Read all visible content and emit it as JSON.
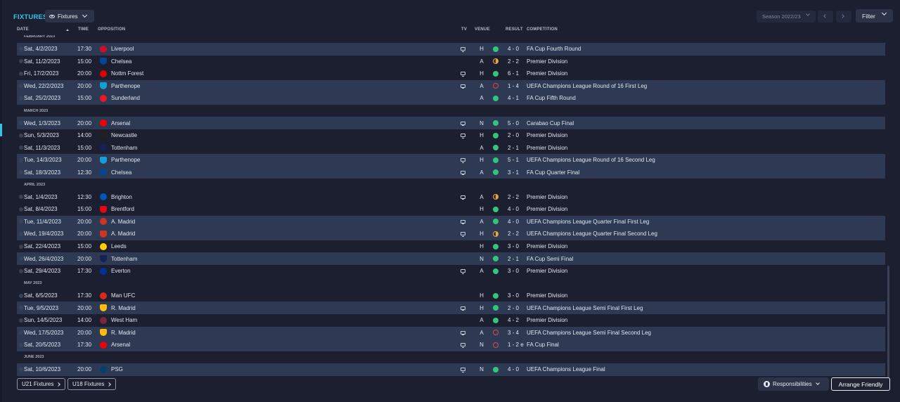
{
  "header": {
    "title": "FIXTURES",
    "view_label": "Fixtures",
    "season_label": "Season 2022/23",
    "filter_label": "Filter"
  },
  "columns": {
    "date": "DATE",
    "time": "TIME",
    "opposition": "OPPOSITION",
    "tv": "TV",
    "venue": "VENUE",
    "result": "RESULT",
    "competition": "COMPETITION"
  },
  "sections": [
    {
      "label": "FEBRUARY 2023",
      "fixtures": [
        {
          "date": "Sat, 4/2/2023",
          "time": "17:30",
          "opponent": "Liverpool",
          "crest": "#c8102e",
          "tv": true,
          "venue": "H",
          "outcome": "win",
          "score": "4 - 0",
          "competition": "FA Cup Fourth Round",
          "highlight": true
        },
        {
          "date": "Sat, 11/2/2023",
          "time": "15:00",
          "opponent": "Chelsea",
          "crest": "#034694",
          "tv": false,
          "venue": "A",
          "outcome": "draw",
          "score": "2 - 2",
          "competition": "Premier Division",
          "highlight": false
        },
        {
          "date": "Fri, 17/2/2023",
          "time": "20:00",
          "opponent": "Nottm Forest",
          "crest": "#dd0000",
          "tv": true,
          "venue": "H",
          "outcome": "win",
          "score": "6 - 1",
          "competition": "Premier Division",
          "highlight": false
        },
        {
          "date": "Wed, 22/2/2023",
          "time": "20:00",
          "opponent": "Parthenope",
          "crest": "#12a0d7",
          "tv": true,
          "venue": "A",
          "outcome": "loss",
          "score": "1 - 4",
          "competition": "UEFA Champions League Round of 16 First Leg",
          "highlight": true
        },
        {
          "date": "Sat, 25/2/2023",
          "time": "15:00",
          "opponent": "Sunderland",
          "crest": "#eb172b",
          "tv": false,
          "venue": "A",
          "outcome": "win",
          "score": "4 - 1",
          "competition": "FA Cup Fifth Round",
          "highlight": true
        }
      ]
    },
    {
      "label": "MARCH 2023",
      "fixtures": [
        {
          "date": "Wed, 1/3/2023",
          "time": "20:00",
          "opponent": "Arsenal",
          "crest": "#ef0107",
          "tv": true,
          "venue": "N",
          "outcome": "win",
          "score": "5 - 0",
          "competition": "Carabao Cup Final",
          "highlight": true
        },
        {
          "date": "Sun, 5/3/2023",
          "time": "14:00",
          "opponent": "Newcastle",
          "crest": "#241f20",
          "tv": true,
          "venue": "H",
          "outcome": "win",
          "score": "2 - 0",
          "competition": "Premier Division",
          "highlight": false
        },
        {
          "date": "Sat, 11/3/2023",
          "time": "15:00",
          "opponent": "Tottenham",
          "crest": "#132257",
          "tv": false,
          "venue": "A",
          "outcome": "win",
          "score": "2 - 1",
          "competition": "Premier Division",
          "highlight": false
        },
        {
          "date": "Tue, 14/3/2023",
          "time": "20:00",
          "opponent": "Parthenope",
          "crest": "#12a0d7",
          "tv": true,
          "venue": "H",
          "outcome": "win",
          "score": "5 - 1",
          "competition": "UEFA Champions League Round of 16 Second Leg",
          "highlight": true
        },
        {
          "date": "Sat, 18/3/2023",
          "time": "12:30",
          "opponent": "Chelsea",
          "crest": "#034694",
          "tv": true,
          "venue": "A",
          "outcome": "win",
          "score": "3 - 1",
          "competition": "FA Cup Quarter Final",
          "highlight": true
        }
      ]
    },
    {
      "label": "APRIL 2023",
      "fixtures": [
        {
          "date": "Sat, 1/4/2023",
          "time": "12:30",
          "opponent": "Brighton",
          "crest": "#0057b8",
          "tv": true,
          "venue": "A",
          "outcome": "draw",
          "score": "2 - 2",
          "competition": "Premier Division",
          "highlight": false
        },
        {
          "date": "Sat, 8/4/2023",
          "time": "15:00",
          "opponent": "Brentford",
          "crest": "#e30613",
          "tv": false,
          "venue": "H",
          "outcome": "win",
          "score": "4 - 0",
          "competition": "Premier Division",
          "highlight": false
        },
        {
          "date": "Tue, 11/4/2023",
          "time": "20:00",
          "opponent": "A. Madrid",
          "crest": "#cb3524",
          "tv": true,
          "venue": "A",
          "outcome": "win",
          "score": "4 - 0",
          "competition": "UEFA Champions League Quarter Final First Leg",
          "highlight": true
        },
        {
          "date": "Wed, 19/4/2023",
          "time": "20:00",
          "opponent": "A. Madrid",
          "crest": "#cb3524",
          "tv": true,
          "venue": "H",
          "outcome": "draw",
          "score": "2 - 2",
          "competition": "UEFA Champions League Quarter Final Second Leg",
          "highlight": true
        },
        {
          "date": "Sat, 22/4/2023",
          "time": "15:00",
          "opponent": "Leeds",
          "crest": "#ffcd00",
          "tv": false,
          "venue": "H",
          "outcome": "win",
          "score": "3 - 0",
          "competition": "Premier Division",
          "highlight": false
        },
        {
          "date": "Wed, 26/4/2023",
          "time": "20:00",
          "opponent": "Tottenham",
          "crest": "#132257",
          "tv": false,
          "venue": "N",
          "outcome": "win",
          "score": "2 - 1",
          "competition": "FA Cup Semi Final",
          "highlight": true
        },
        {
          "date": "Sat, 29/4/2023",
          "time": "17:30",
          "opponent": "Everton",
          "crest": "#003399",
          "tv": true,
          "venue": "A",
          "outcome": "win",
          "score": "3 - 0",
          "competition": "Premier Division",
          "highlight": false
        }
      ]
    },
    {
      "label": "MAY 2023",
      "fixtures": [
        {
          "date": "Sat, 6/5/2023",
          "time": "17:30",
          "opponent": "Man UFC",
          "crest": "#da291c",
          "tv": false,
          "venue": "H",
          "outcome": "win",
          "score": "3 - 0",
          "competition": "Premier Division",
          "highlight": false
        },
        {
          "date": "Tue, 9/5/2023",
          "time": "20:00",
          "opponent": "R. Madrid",
          "crest": "#febe10",
          "tv": true,
          "venue": "H",
          "outcome": "win",
          "score": "2 - 0",
          "competition": "UEFA Champions League Semi Final First Leg",
          "highlight": true
        },
        {
          "date": "Sun, 14/5/2023",
          "time": "14:00",
          "opponent": "West Ham",
          "crest": "#7a263a",
          "tv": false,
          "venue": "A",
          "outcome": "win",
          "score": "4 - 2",
          "competition": "Premier Division",
          "highlight": false
        },
        {
          "date": "Wed, 17/5/2023",
          "time": "20:00",
          "opponent": "R. Madrid",
          "crest": "#febe10",
          "tv": true,
          "venue": "A",
          "outcome": "loss",
          "score": "3 - 4",
          "competition": "UEFA Champions League Semi Final Second Leg",
          "highlight": true
        },
        {
          "date": "Sat, 20/5/2023",
          "time": "17:30",
          "opponent": "Arsenal",
          "crest": "#ef0107",
          "tv": true,
          "venue": "N",
          "outcome": "loss",
          "score": "1 - 2 e",
          "competition": "FA Cup Final",
          "highlight": true
        }
      ]
    },
    {
      "label": "JUNE 2023",
      "fixtures": [
        {
          "date": "Sat, 10/6/2023",
          "time": "20:00",
          "opponent": "PSG",
          "crest": "#004170",
          "tv": true,
          "venue": "N",
          "outcome": "win",
          "score": "4 - 0",
          "competition": "UEFA Champions League Final",
          "highlight": true
        }
      ]
    }
  ],
  "footer": {
    "u21_label": "U21 Fixtures",
    "u18_label": "U18 Fixtures",
    "responsibilities_label": "Responsibilities",
    "arrange_label": "Arrange Friendly"
  }
}
